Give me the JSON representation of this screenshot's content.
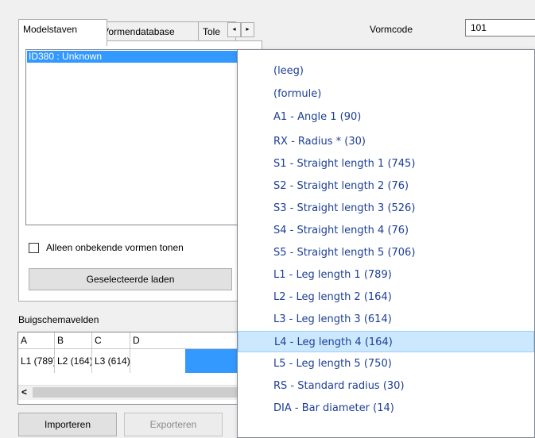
{
  "tabs": [
    "Modelstaven",
    "Vormendatabase",
    "Tole"
  ],
  "tab_scroll": {
    "left": "◂",
    "right": "▸"
  },
  "list": {
    "selected_item": "ID380 : Unknown"
  },
  "checkbox_label": "Alleen onbekende vormen tonen",
  "load_button": "Geselecteerde laden",
  "vormcode": {
    "label": "Vormcode",
    "value": "101"
  },
  "grid": {
    "title": "Buigschemavelden",
    "columns": [
      "A",
      "B",
      "C",
      "D"
    ],
    "row": [
      "L1 (789)",
      "L2 (164)",
      "L3 (614)",
      ""
    ],
    "scroll_left": "<"
  },
  "buttons": {
    "import": "Importeren",
    "export": "Exporteren"
  },
  "dropdown": {
    "selected_index": 14,
    "items": [
      "(leeg)",
      "(formule)",
      "A1 - Angle 1 (90)",
      "RX - Radius * (30)",
      "S1 - Straight length 1 (745)",
      "S2 - Straight length 2 (76)",
      "S3 - Straight length 3 (526)",
      "S4 - Straight length 4 (76)",
      "S5 - Straight length 5 (706)",
      "L1 - Leg length 1 (789)",
      "L2 - Leg length 2 (164)",
      "L3 - Leg length 3 (614)",
      "L4 - Leg length 4 (164)",
      "L5 - Leg length 5 (750)",
      "RS - Standard radius (30)",
      "DIA - Bar diameter (14)"
    ]
  },
  "colors": {
    "selection": "#3399ff",
    "dropdown_text": "#1c3f94",
    "highlight": "#cce8ff"
  }
}
